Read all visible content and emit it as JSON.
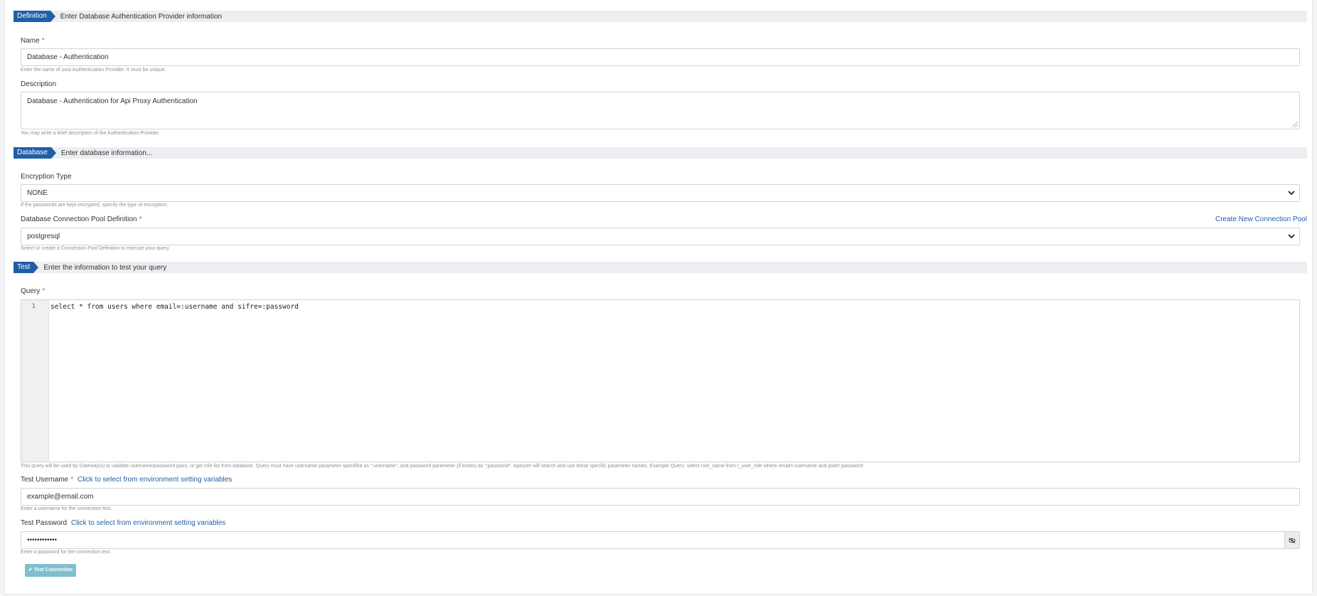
{
  "sections": {
    "definition": {
      "tag": "Definition",
      "text": "Enter Database Authentication Provider information"
    },
    "database": {
      "tag": "Database",
      "text": "Enter database information..."
    },
    "test": {
      "tag": "Test",
      "text": "Enter the information to test your query"
    }
  },
  "name": {
    "label": "Name",
    "required": "*",
    "value": "Database  - Authentication",
    "hint": "Enter the name of your Authentication Provider. It must be unique."
  },
  "description": {
    "label": "Description",
    "value": "Database - Authentication for Api Proxy Authentication",
    "hint": "You may write a brief description of the Authentication Provider."
  },
  "encryption": {
    "label": "Encryption Type",
    "value": "NONE",
    "hint": "If the passwords are kept encrypted, specify the type of encryption."
  },
  "pool": {
    "label": "Database Connection Pool Definition",
    "required": "*",
    "value": "postgresql",
    "hint": "Select or create a Connection Pool Definition to execute your query.",
    "create_link": "Create New Connection Pool"
  },
  "query": {
    "label": "Query",
    "required": "*",
    "line_number": "1",
    "code": "select * from users where email=:username and sifre=:password",
    "hint": "This query will be used by Gateway(s) to validate username/password pairs, or get role list from database. Query must have username parameter specified as \":username\", and password parameter (if exists) as \":password\". Apinizer will search and use these specific parameter names. Example Query: select role_name from t_user_role where email=:username and pwd=:password"
  },
  "test_username": {
    "label": "Test Username",
    "required": "*",
    "env_link": "Click to select from environment setting variables",
    "value": "example@email.com",
    "hint": "Enter a username for the connection test."
  },
  "test_password": {
    "label": "Test Password",
    "env_link": "Click to select from environment setting variables",
    "value": "••••••••••••",
    "hint": "Enter a password for the connection test."
  },
  "test_button": {
    "label": "✔ Test Connection"
  },
  "icons": {
    "select": "chevron-down-icon",
    "password": "eye-slash-icon"
  },
  "colors": {
    "accent": "#215ea8",
    "button": "#7fbfcf",
    "required": "#d9534f"
  }
}
